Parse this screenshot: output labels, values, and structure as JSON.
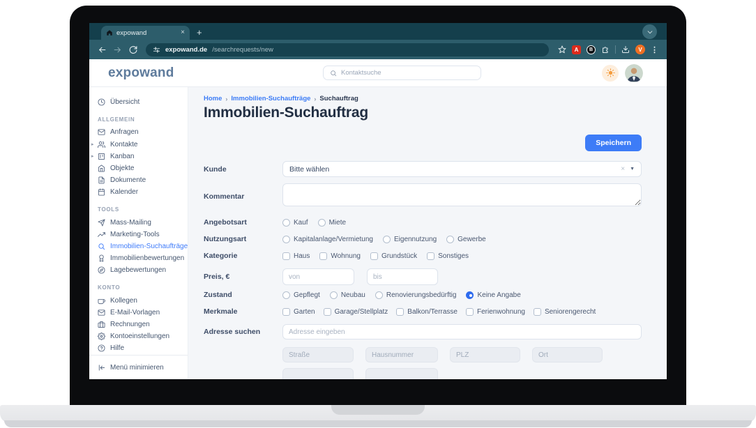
{
  "browser": {
    "tab_title": "expowand",
    "close_tab": "×",
    "new_tab": "+",
    "url_domain": "expowand.de",
    "url_path": "/searchrequests/new",
    "ext_pdf_label": "A",
    "ext_b_label": "B",
    "profile_initial": "V",
    "menu_dots": "⋮"
  },
  "header": {
    "logo": "expowand",
    "search_placeholder": "Kontaktsuche"
  },
  "sidebar": {
    "overview_label": "Übersicht",
    "caret": "▸",
    "sections": [
      {
        "title": "ALLGEMEIN",
        "items": [
          {
            "label": "Anfragen"
          },
          {
            "label": "Kontakte"
          },
          {
            "label": "Kanban"
          },
          {
            "label": "Objekte"
          },
          {
            "label": "Dokumente"
          },
          {
            "label": "Kalender"
          }
        ]
      },
      {
        "title": "TOOLS",
        "items": [
          {
            "label": "Mass-Mailing"
          },
          {
            "label": "Marketing-Tools"
          },
          {
            "label": "Immobilien-Suchaufträge"
          },
          {
            "label": "Immobilienbewertungen"
          },
          {
            "label": "Lagebewertungen"
          }
        ]
      },
      {
        "title": "KONTO",
        "items": [
          {
            "label": "Kollegen"
          },
          {
            "label": "E-Mail-Vorlagen"
          },
          {
            "label": "Rechnungen"
          },
          {
            "label": "Kontoeinstellungen"
          },
          {
            "label": "Hilfe"
          }
        ]
      }
    ],
    "minimize_label": "Menü minimieren"
  },
  "breadcrumb": {
    "home": "Home",
    "list": "Immobilien-Suchaufträge",
    "current": "Suchauftrag",
    "sep": "›"
  },
  "page": {
    "title": "Immobilien-Suchauftrag",
    "save_button": "Speichern"
  },
  "form": {
    "kunde_label": "Kunde",
    "kunde_value": "Bitte wählen",
    "kommentar_label": "Kommentar",
    "angebotsart_label": "Angebotsart",
    "angebotsart_options": [
      "Kauf",
      "Miete"
    ],
    "nutzungsart_label": "Nutzungsart",
    "nutzungsart_options": [
      "Kapitalanlage/Vermietung",
      "Eigennutzung",
      "Gewerbe"
    ],
    "kategorie_label": "Kategorie",
    "kategorie_options": [
      "Haus",
      "Wohnung",
      "Grundstück",
      "Sonstiges"
    ],
    "preis_label": "Preis, €",
    "preis_von_placeholder": "von",
    "preis_bis_placeholder": "bis",
    "zustand_label": "Zustand",
    "zustand_options": [
      "Gepflegt",
      "Neubau",
      "Renovierungsbedürftig",
      "Keine Angabe"
    ],
    "zustand_selected": "Keine Angabe",
    "merkmale_label": "Merkmale",
    "merkmale_options": [
      "Garten",
      "Garage/Stellplatz",
      "Balkon/Terrasse",
      "Ferienwohnung",
      "Seniorengerecht"
    ],
    "adresse_label": "Adresse suchen",
    "adresse_placeholder": "Adresse eingeben",
    "address_placeholders": [
      "Straße",
      "Hausnummer",
      "PLZ",
      "Ort"
    ]
  },
  "colors": {
    "chrome_teal": "#2d5d6b",
    "chrome_dark": "#143f4c",
    "accent_blue": "#3d7cf7",
    "active_nav_blue": "#3e7bfa",
    "profile_orange": "#ee6f23",
    "main_bg": "#f4f6f9"
  }
}
